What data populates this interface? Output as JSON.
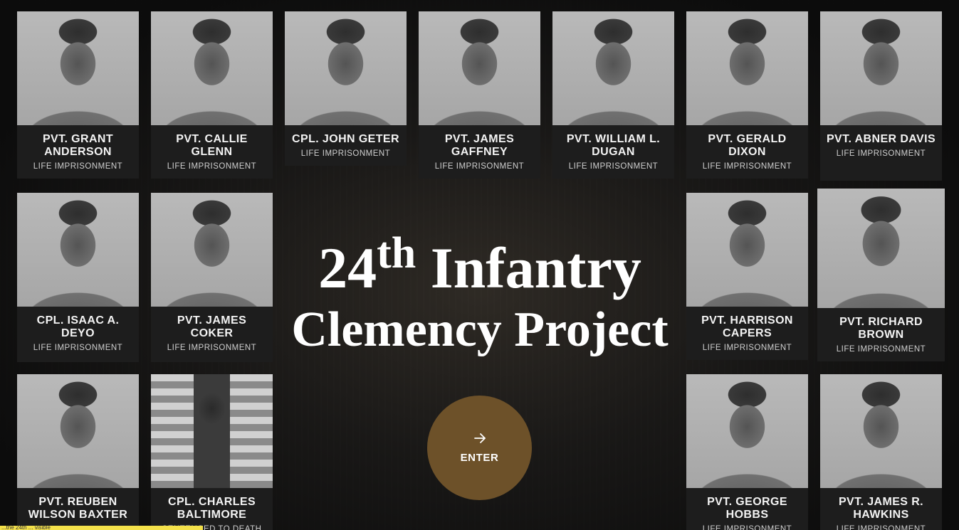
{
  "title": {
    "number": "24",
    "suffix": "th",
    "line1_rest": "Infantry",
    "line2": "Clemency Project"
  },
  "enter_button": {
    "icon": "arrow-right-icon",
    "label": "ENTER"
  },
  "cards": [
    {
      "name": "PVT. GRANT ANDERSON",
      "sentence": "LIFE IMPRISONMENT"
    },
    {
      "name": "PVT. CALLIE GLENN",
      "sentence": "LIFE IMPRISONMENT"
    },
    {
      "name": "CPL. JOHN GETER",
      "sentence": "LIFE IMPRISONMENT"
    },
    {
      "name": "PVT. JAMES GAFFNEY",
      "sentence": "LIFE IMPRISONMENT"
    },
    {
      "name": "PVT. WILLIAM L. DUGAN",
      "sentence": "LIFE IMPRISONMENT"
    },
    {
      "name": "PVT. GERALD DIXON",
      "sentence": "LIFE IMPRISONMENT"
    },
    {
      "name": "PVT. ABNER DAVIS",
      "sentence": "LIFE IMPRISONMENT"
    },
    {
      "name": "CPL. ISAAC A. DEYO",
      "sentence": "LIFE IMPRISONMENT"
    },
    {
      "name": "PVT. JAMES COKER",
      "sentence": "LIFE IMPRISONMENT"
    },
    {
      "name": "PVT. HARRISON CAPERS",
      "sentence": "LIFE IMPRISONMENT"
    },
    {
      "name": "PVT. RICHARD BROWN",
      "sentence": "LIFE IMPRISONMENT"
    },
    {
      "name": "PVT. REUBEN WILSON BAXTER",
      "sentence": ""
    },
    {
      "name": "CPL. CHARLES BALTIMORE",
      "sentence": "SENTENCED TO DEATH"
    },
    {
      "name": "PVT. GEORGE HOBBS",
      "sentence": "LIFE IMPRISONMENT"
    },
    {
      "name": "PVT. JAMES R. HAWKINS",
      "sentence": "LIFE IMPRISONMENT"
    }
  ],
  "status_bar": {
    "text": "...the 24th ... visible"
  },
  "colors": {
    "accent": "#6d5129",
    "card_background": "#1d1d1d",
    "page_background": "#121212"
  }
}
